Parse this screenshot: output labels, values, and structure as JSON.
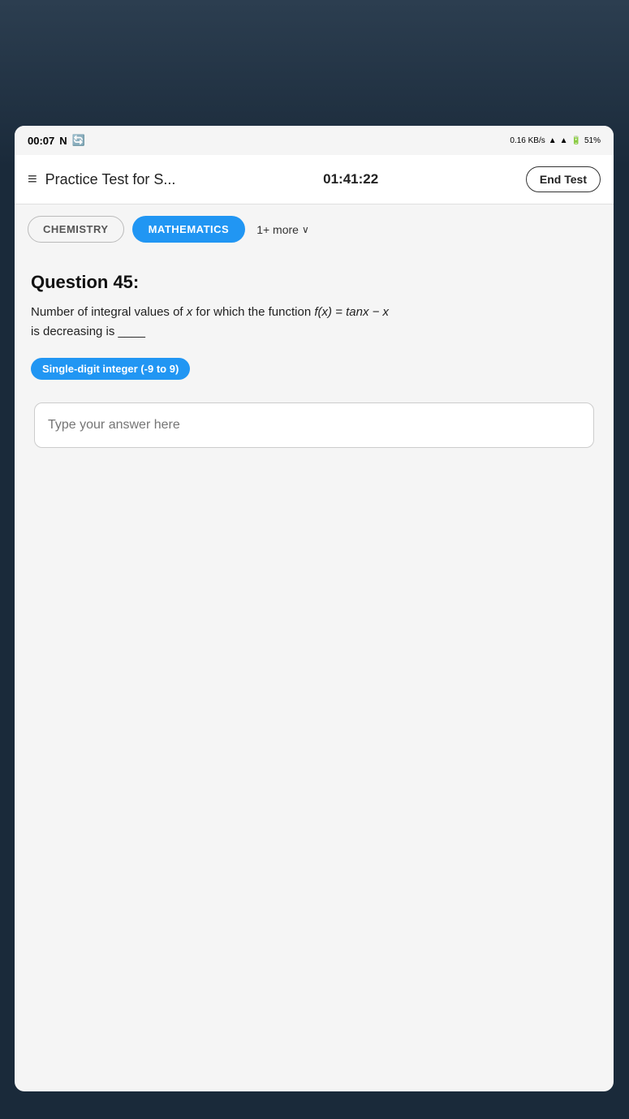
{
  "status_bar": {
    "time": "00:07",
    "network_speed": "0.16 KB/s",
    "battery": "51%"
  },
  "header": {
    "menu_label": "≡",
    "title": "Practice Test for S...",
    "timer": "01:41:22",
    "end_test_label": "End Test"
  },
  "tabs": {
    "chemistry_label": "CHEMISTRY",
    "mathematics_label": "MATHEMATICS",
    "more_label": "1+ more"
  },
  "question": {
    "number": "Question 45:",
    "text_part1": "Number of integral values of x for which the function f(x) = tanx − x",
    "text_part2": "is decreasing is ____",
    "answer_type": "Single-digit integer (-9 to 9)",
    "input_placeholder": "Type your answer here"
  }
}
